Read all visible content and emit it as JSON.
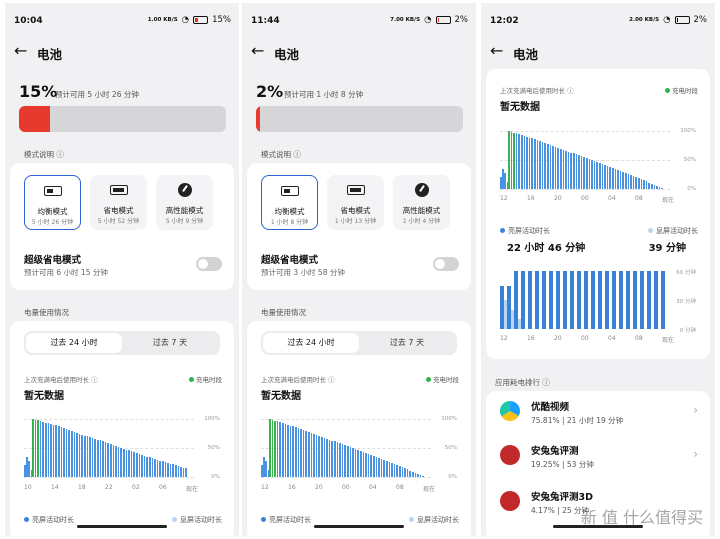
{
  "screens": [
    {
      "status": {
        "time": "10:04",
        "net": "1.00 KB/S",
        "battery": "15%"
      },
      "appbar": {
        "back": "←",
        "title": "电池"
      },
      "battery": {
        "percent": "15%",
        "percent_value": 15,
        "estimate": "预计可用 5 小时 26 分钟"
      },
      "modes_label": "模式说明 ⓘ",
      "modes": [
        {
          "name": "均衡模式",
          "time": "5 小时 26 分钟",
          "icon": "battery-icon"
        },
        {
          "name": "省电模式",
          "time": "5 小时 52 分钟",
          "icon": "battery-saver-icon"
        },
        {
          "name": "高性能模式",
          "time": "5 小时 9 分钟",
          "icon": "gauge-icon"
        }
      ],
      "super_saver": {
        "title": "超级省电模式",
        "subtitle": "预计可用 6 小时 15 分钟"
      },
      "usage_label": "电量使用情况",
      "tabs": [
        "过去 24 小时",
        "过去 7 天"
      ],
      "chart_head": "上次充满电后使用时长 ⓘ",
      "charge_legend": "充电时段",
      "no_data": "暂无数据",
      "y_ticks": [
        "100%",
        "50%",
        "0%"
      ],
      "x_ticks": [
        "10",
        "14",
        "18",
        "22",
        "02",
        "06",
        "现在"
      ],
      "screen_on_label": "亮屏活动时长",
      "screen_off_label": "息屏活动时长"
    },
    {
      "status": {
        "time": "11:44",
        "net": "7.00 KB/S",
        "battery": "2%"
      },
      "appbar": {
        "back": "←",
        "title": "电池"
      },
      "battery": {
        "percent": "2%",
        "percent_value": 2,
        "estimate": "预计可用 1 小时 8 分钟"
      },
      "modes_label": "模式说明 ⓘ",
      "modes": [
        {
          "name": "均衡模式",
          "time": "1 小时 8 分钟",
          "icon": "battery-icon"
        },
        {
          "name": "省电模式",
          "time": "1 小时 13 分钟",
          "icon": "battery-saver-icon"
        },
        {
          "name": "高性能模式",
          "time": "1 小时 4 分钟",
          "icon": "gauge-icon"
        }
      ],
      "super_saver": {
        "title": "超级省电模式",
        "subtitle": "预计可用 3 小时 58 分钟"
      },
      "usage_label": "电量使用情况",
      "tabs": [
        "过去 24 小时",
        "过去 7 天"
      ],
      "chart_head": "上次充满电后使用时长 ⓘ",
      "charge_legend": "充电时段",
      "no_data": "暂无数据",
      "y_ticks": [
        "100%",
        "50%",
        "0%"
      ],
      "x_ticks": [
        "12",
        "16",
        "20",
        "00",
        "04",
        "08",
        "现在"
      ],
      "screen_on_label": "亮屏活动时长",
      "screen_off_label": "息屏活动时长"
    },
    {
      "status": {
        "time": "12:02",
        "net": "2.00 KB/S",
        "battery": "2%"
      },
      "appbar": {
        "back": "←",
        "title": "电池"
      },
      "chart_head": "上次充满电后使用时长 ⓘ",
      "charge_legend": "充电时段",
      "no_data": "暂无数据",
      "y_ticks": [
        "100%",
        "50%",
        "0%"
      ],
      "x_ticks": [
        "12",
        "16",
        "20",
        "00",
        "04",
        "08",
        "现在"
      ],
      "screen_on": {
        "label": "亮屏活动时长",
        "value": "22 小时 46 分钟"
      },
      "screen_off": {
        "label": "息屏活动时长",
        "value": "39 分钟"
      },
      "min_ticks": [
        "60 分钟",
        "30 分钟",
        "0 分钟"
      ],
      "rank_title": "应用耗电排行 ⓘ",
      "apps": [
        {
          "name": "优酷视频",
          "stat": "75.81% | 21 小时 19 分钟",
          "icon": "youku-icon",
          "color": "#1aa0ff"
        },
        {
          "name": "安兔兔评测",
          "stat": "19.25% | 53 分钟",
          "icon": "antutu-icon",
          "color": "#c0282a"
        },
        {
          "name": "安兔兔评测3D",
          "stat": "4.17% | 25 分钟",
          "icon": "antutu-3d-icon",
          "color": "#c0282a"
        }
      ],
      "watermark": "新 值 什么值得买"
    }
  ],
  "chart_data": [
    {
      "type": "bar",
      "title": "上次充满电后使用时长",
      "ylim": [
        0,
        100
      ],
      "y_ticks": [
        "100%",
        "50%",
        "0%"
      ],
      "x_ticks": [
        "10",
        "14",
        "18",
        "22",
        "02",
        "06",
        "现在"
      ],
      "series": [
        {
          "name": "充电时段",
          "values": [
            8,
            22,
            18,
            14,
            10,
            6,
            4
          ]
        },
        {
          "name": "",
          "values": [
            100,
            88,
            72,
            58,
            42,
            28,
            15
          ]
        }
      ]
    },
    {
      "type": "bar",
      "title": "上次充满电后使用时长",
      "ylim": [
        0,
        100
      ],
      "y_ticks": [
        "100%",
        "50%",
        "0%"
      ],
      "x_ticks": [
        "12",
        "16",
        "20",
        "00",
        "04",
        "08",
        "现在"
      ],
      "series": [
        {
          "name": "",
          "values": [
            100,
            86,
            70,
            54,
            38,
            20,
            2
          ]
        }
      ]
    },
    {
      "type": "bar",
      "title": "亮屏/息屏活动时长",
      "ylim": [
        0,
        60
      ],
      "y_ticks": [
        "60 分钟",
        "30 分钟",
        "0 分钟"
      ],
      "x_ticks": [
        "12",
        "16",
        "20",
        "00",
        "04",
        "08",
        "现在"
      ],
      "series": [
        {
          "name": "亮屏活动时长",
          "values": [
            60,
            60,
            60,
            60,
            60,
            60,
            60
          ]
        },
        {
          "name": "息屏活动时长",
          "values": [
            30,
            20,
            10,
            0,
            0,
            0,
            0
          ]
        }
      ]
    }
  ]
}
